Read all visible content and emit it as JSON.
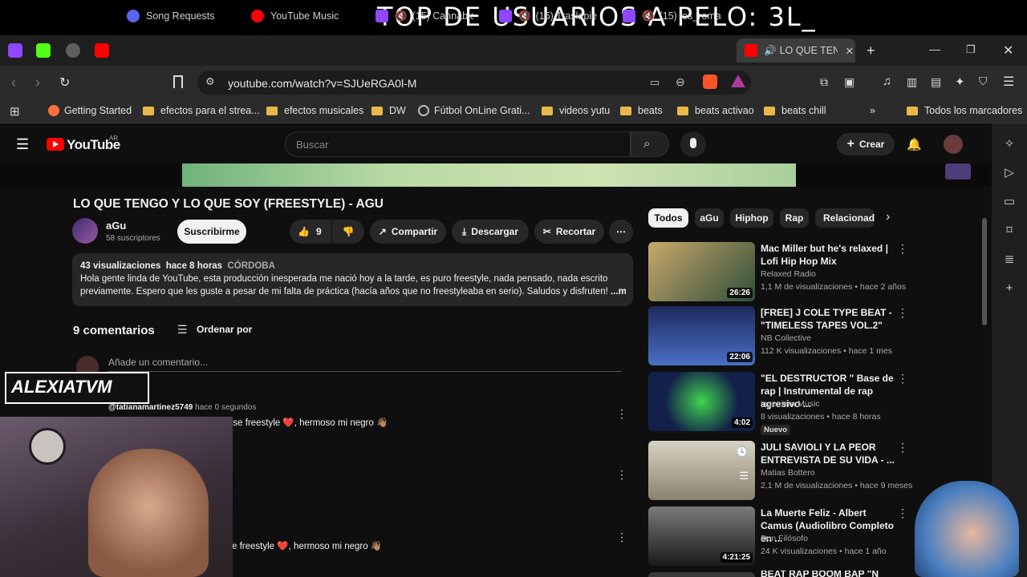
{
  "stream": {
    "top_banner": "TOP DE USUARIOS A PELO:   3L_",
    "overlay_logo": "ALEXIATVM"
  },
  "browser": {
    "tabs": [
      {
        "label": "Song Requests"
      },
      {
        "label": "YouTube Music"
      },
      {
        "label": "(15) Cannabico("
      },
      {
        "label": "(15) Traslapiel -"
      },
      {
        "label": "(15) los_romani"
      },
      {
        "label": "LO QUE TEN"
      }
    ],
    "url": "youtube.com/watch?v=SJUeRGA0l-M",
    "bookmarks": [
      {
        "label": "Getting Started"
      },
      {
        "label": "efectos para el strea..."
      },
      {
        "label": "efectos musicales"
      },
      {
        "label": "DW"
      },
      {
        "label": "Fútbol OnLine Grati..."
      },
      {
        "label": "videos yutu"
      },
      {
        "label": "beats"
      },
      {
        "label": "beats activao"
      },
      {
        "label": "beats chill"
      }
    ],
    "all_bookmarks": "Todos los marcadores"
  },
  "youtube": {
    "logo": "YouTube",
    "region": "AR",
    "search_placeholder": "Buscar",
    "create_label": "Crear",
    "video": {
      "title": "LO QUE TENGO Y LO QUE SOY (FREESTYLE) - AGU",
      "channel": "aGu",
      "subscribers": "58 suscriptores",
      "subscribe_label": "Suscribirme",
      "likes": "9",
      "share_label": "Compartir",
      "download_label": "Descargar",
      "clip_label": "Recortar",
      "views": "43 visualizaciones",
      "published": "hace 8 horas",
      "location": "CÓRDOBA",
      "description_line1": "Hola gente linda de YouTube, esta producción inesperada me nació hoy a la tarde, es puro freestyle, nada pensado, nada escrito",
      "description_line2": "previamente. Espero que les guste a pesar de mi falta de práctica (hacía años que no freestyleaba en serio). Saludos y disfruten!",
      "more_label": "...más"
    },
    "comments": {
      "count_label": "9 comentarios",
      "sort_label": "Ordenar por",
      "add_placeholder": "Añade un comentario...",
      "items": [
        {
          "author": "@tatianamartinez5749",
          "time": "hace 0 segundos",
          "text": "La transparencia que hay en ese freestyle ❤️, hermoso mi negro 👋🏽"
        },
        {
          "author": "",
          "time": "",
          "text": ""
        },
        {
          "author": "",
          "time": "",
          "text": "e freestyle ❤️, hermoso mi negro 👋🏽"
        }
      ]
    },
    "chips": [
      "Todos",
      "aGu",
      "Hiphop",
      "Rap",
      "Relacionado"
    ],
    "recommendations": [
      {
        "title": "Mac Miller but he's relaxed | Lofi Hip Hop Mix",
        "channel": "Relaxed Radio",
        "meta": "1,1 M de visualizaciones • hace 2 años",
        "duration": "26:26",
        "badge": ""
      },
      {
        "title": "[FREE] J COLE TYPE BEAT - \"TIMELESS TAPES VOL.2\"",
        "channel": "NB Collective",
        "meta": "112 K visualizaciones • hace 1 mes",
        "duration": "22:06",
        "badge": ""
      },
      {
        "title": "\"EL DESTRUCTOR \" Base de rap | Instrumental de rap agresivo ...",
        "channel": "ingeniera Music",
        "meta": "8 visualizaciones • hace 8 horas",
        "duration": "4:02",
        "badge": "Nuevo"
      },
      {
        "title": "JULI SAVIOLI Y LA PEOR ENTREVISTA DE SU VIDA - ...",
        "channel": "Matias Bottero",
        "meta": "2,1 M de visualizaciones • hace 9 meses",
        "duration": "",
        "badge": ""
      },
      {
        "title": "La Muerte Feliz - Albert Camus (Audiolibro Completo en ...",
        "channel": "Don Filósofo",
        "meta": "24 K visualizaciones • hace 1 año",
        "duration": "4:21:25",
        "badge": ""
      },
      {
        "title": "BEAT RAP BOOM BAP \"N",
        "channel": "",
        "meta": "",
        "duration": "",
        "badge": ""
      }
    ]
  },
  "colors": {
    "yt_red": "#ff0000",
    "twitch_purple": "#9146ff",
    "folder": "#e8b84a",
    "chip_bg": "#272727",
    "chip_active": "#f1f1f1"
  }
}
